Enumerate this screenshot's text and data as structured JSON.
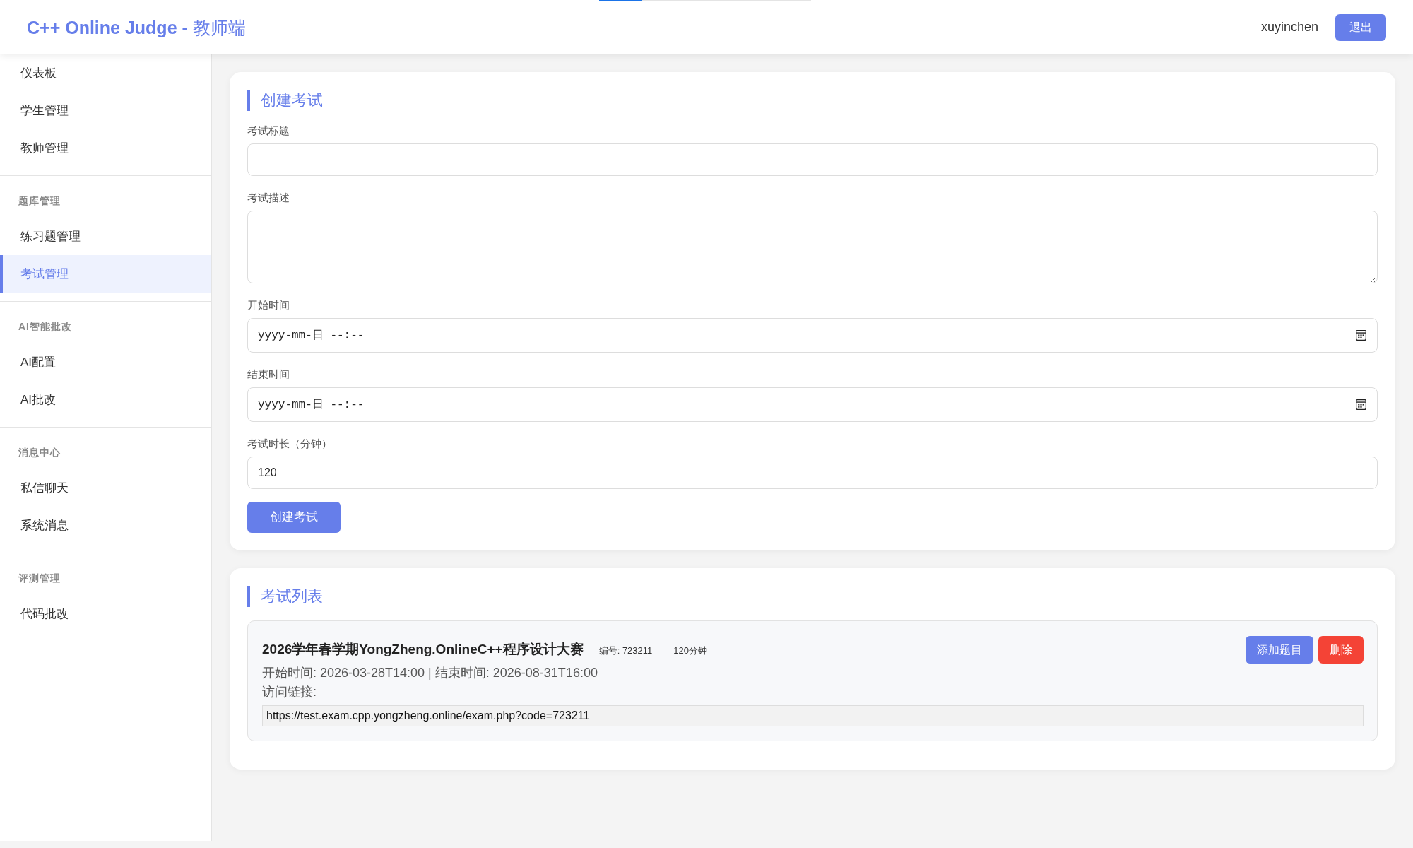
{
  "header": {
    "title": "**C++ Online Judge -** 教师端",
    "username": "xuyinchen",
    "logout_button": "退出"
  },
  "page_loader": {
    "level": 0.2
  },
  "sidebar": {
    "sections": [
      {
        "items": [
          {
            "label": "仪表板",
            "selected": false
          },
          {
            "label": "学生管理",
            "selected": false
          },
          {
            "label": "教师管理",
            "selected": false
          }
        ]
      },
      {
        "heading": "题库管理",
        "items": [
          {
            "label": "练习题管理",
            "selected": false
          },
          {
            "label": "考试管理",
            "selected": true
          }
        ]
      },
      {
        "heading": "AI智能批改",
        "items": [
          {
            "label": "AI配置",
            "selected": false
          },
          {
            "label": "AI批改",
            "selected": false
          }
        ]
      },
      {
        "heading": "消息中心",
        "items": [
          {
            "label": "私信聊天",
            "selected": false
          },
          {
            "label": "系统消息",
            "selected": false
          }
        ]
      },
      {
        "heading": "评测管理",
        "items": [
          {
            "label": "代码批改",
            "selected": false
          }
        ]
      }
    ]
  },
  "create_form": {
    "title": "创建考试",
    "fields": [
      {
        "kind": "text",
        "label": "考试标题"
      },
      {
        "kind": "textarea",
        "label": "考试描述"
      },
      {
        "kind": "datetime",
        "label": "开始时间",
        "placeholder": "yyyy-mm-日 --:--"
      },
      {
        "kind": "datetime",
        "label": "结束时间",
        "placeholder": "yyyy-mm-日 --:--"
      },
      {
        "kind": "text",
        "label": "考试时长（分钟）",
        "value": "120"
      }
    ],
    "submit_button": "创建考试"
  },
  "exam_list": {
    "title": "考试列表",
    "exams": [
      {
        "name": "2026学年春学期YongZheng.OnlineC++程序设计大赛",
        "code": "编号: 723211",
        "duration": "120分钟",
        "schedule": "开始时间: 2026-03-28T14:00 | 结束时间: 2026-08-31T16:00",
        "link_label": "访问链接:",
        "link": "https://test.exam.cpp.yongzheng.online/exam.php?code=723211",
        "buttons": [
          {
            "label": "添加题目",
            "kind": "primary"
          },
          {
            "label": "删除",
            "kind": "danger"
          }
        ]
      }
    ]
  }
}
